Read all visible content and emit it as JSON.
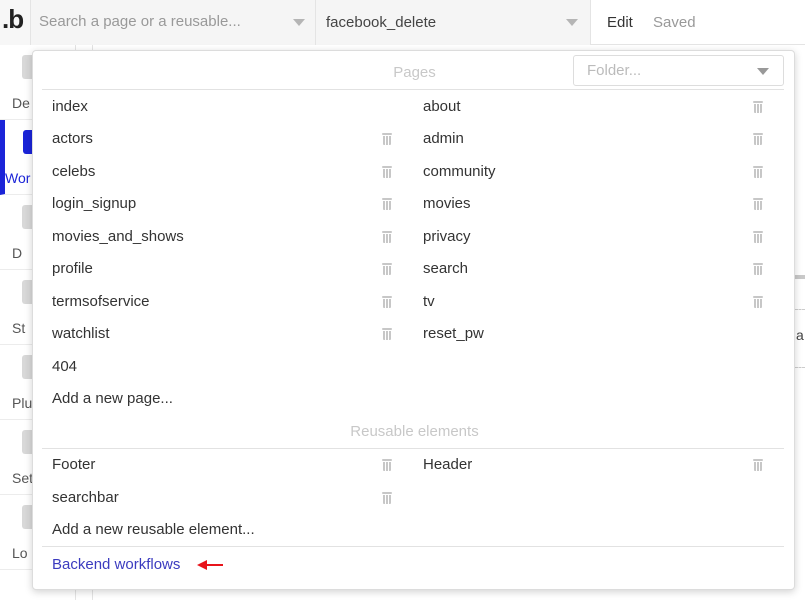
{
  "topbar": {
    "logo_text": ".b",
    "search_placeholder": "Search a page or a reusable...",
    "current_page": "facebook_delete",
    "edit_label": "Edit",
    "status": "Saved"
  },
  "sidebar": {
    "items": [
      {
        "label": "De",
        "icon": "design-icon"
      },
      {
        "label": "Wor",
        "icon": "workflow-icon",
        "active": true
      },
      {
        "label": "D",
        "icon": "data-icon"
      },
      {
        "label": "St",
        "icon": "styles-icon"
      },
      {
        "label": "Plu",
        "icon": "plugins-icon"
      },
      {
        "label": "Set",
        "icon": "settings-icon"
      },
      {
        "label": "Lo",
        "icon": "logs-icon"
      }
    ]
  },
  "canvas_peek": {
    "text": "a"
  },
  "popup": {
    "folder_placeholder": "Folder...",
    "pages_title": "Pages",
    "pages_left": [
      "index",
      "actors",
      "celebs",
      "login_signup",
      "movies_and_shows",
      "profile",
      "termsofservice",
      "watchlist",
      "404"
    ],
    "pages_right": [
      "about",
      "admin",
      "community",
      "movies",
      "privacy",
      "search",
      "tv",
      "reset_pw"
    ],
    "add_page_label": "Add a new page...",
    "reusable_title": "Reusable elements",
    "reusable_left": [
      "Footer",
      "searchbar"
    ],
    "reusable_right": [
      "Header"
    ],
    "add_reusable_label": "Add a new reusable element...",
    "backend_label": "Backend workflows",
    "accent_color": "#3b3bbf",
    "arrow_color": "#e8141b"
  }
}
